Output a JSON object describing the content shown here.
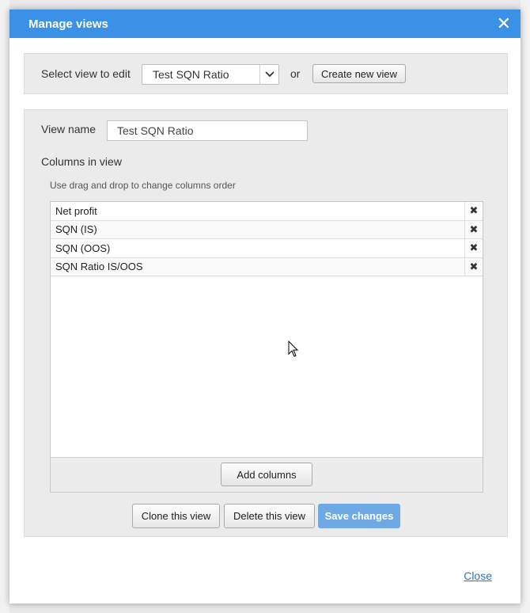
{
  "dialog": {
    "title": "Manage views",
    "close_icon": "close-icon"
  },
  "select_row": {
    "label": "Select view to edit",
    "selected_view": "Test SQN Ratio",
    "or_text": "or",
    "create_button": "Create new view"
  },
  "editor": {
    "view_name_label": "View name",
    "view_name_value": "Test SQN Ratio",
    "columns_label": "Columns in view",
    "hint": "Use drag and drop to change columns order",
    "columns": [
      {
        "label": "Net profit"
      },
      {
        "label": "SQN (IS)"
      },
      {
        "label": "SQN (OOS)"
      },
      {
        "label": "SQN Ratio IS/OOS"
      }
    ],
    "add_columns_button": "Add columns",
    "clone_button": "Clone this view",
    "delete_button": "Delete this view",
    "save_button": "Save changes"
  },
  "footer": {
    "close_link": "Close"
  },
  "colors": {
    "titlebar": "#3b91e6",
    "primary_button": "#6fa9e4",
    "link": "#2b74c7"
  }
}
